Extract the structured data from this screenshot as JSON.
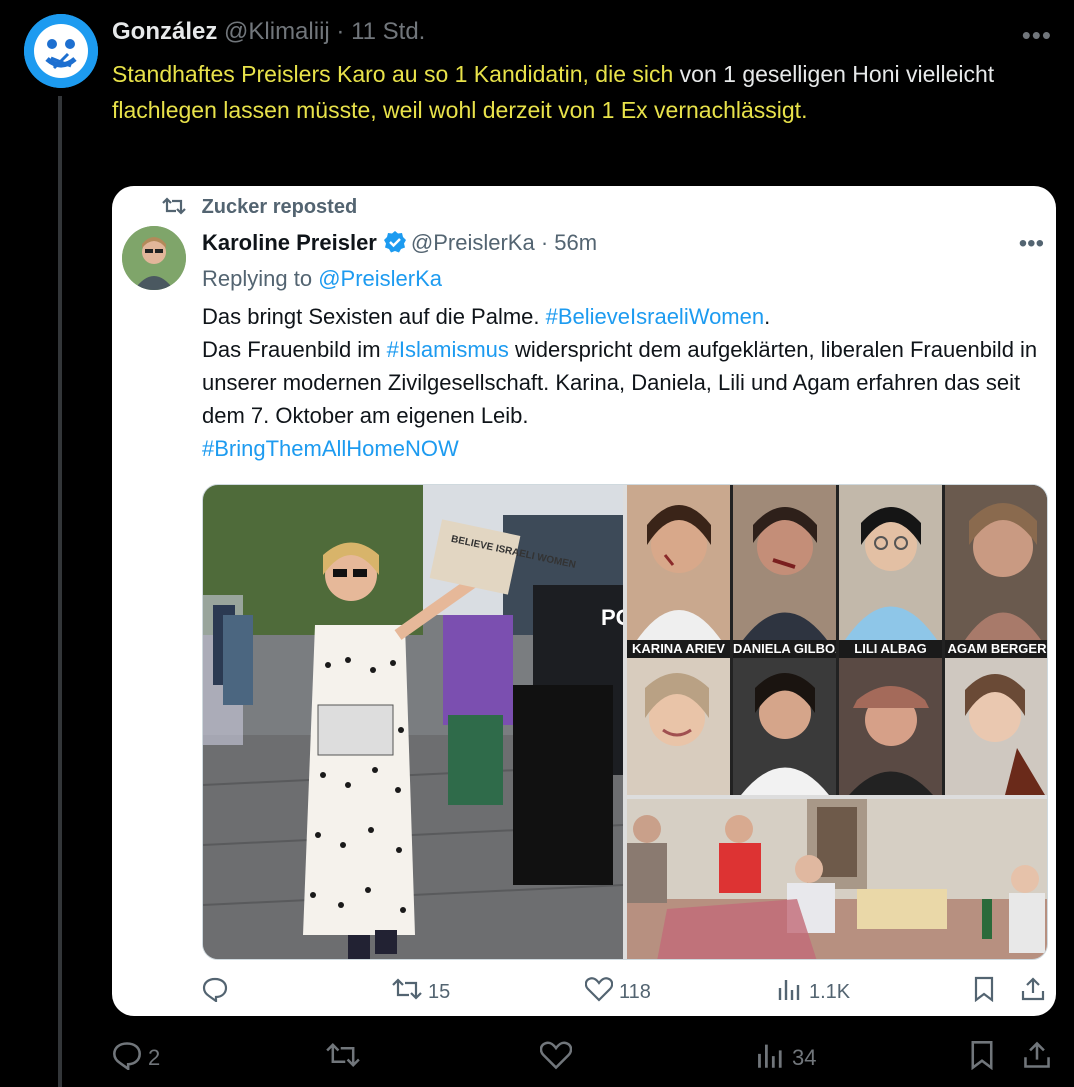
{
  "outer_post": {
    "author_name": "González",
    "handle": "@Klimaliij",
    "separator": "·",
    "time": "11 Std.",
    "text_segments": [
      {
        "text": "Standhaftes Preislers Karo au so 1 Kandidatin, die sich",
        "highlight": true
      },
      {
        "text": " von 1 geselligen Honi vielleicht ",
        "highlight": false
      },
      {
        "text": "flachlegen lassen müsste, weil wohl derzeit von 1 Ex vernachlässigt.",
        "highlight": true
      }
    ],
    "more_icon": "more-dots-icon",
    "actions": {
      "reply_count": "2",
      "repost_count": "",
      "like_count": "",
      "views_count": "34"
    }
  },
  "quoted_post": {
    "repost_label": "Zucker reposted",
    "author_name": "Karoline Preisler",
    "handle": "@PreislerKa",
    "separator": "·",
    "time": "56m",
    "replying_prefix": "Replying to",
    "replying_handle": "@PreislerKa",
    "line1_text": "Das bringt Sexisten auf die Palme. ",
    "line1_tag": "#BelieveIsraeliWomen",
    "line1_end": ".",
    "line2_text": "Das Frauenbild im ",
    "line2_tag": "#Islamismus",
    "line2_rest": " widerspricht dem aufgeklärten, liberalen Frauenbild in unserer modernen Zivilgesellschaft. Karina, Daniela, Lili und Agam erfahren das seit dem 7. Oktober am eigenen Leib.",
    "line3_tag": "#BringThemAllHomeNOW",
    "media": {
      "sign_text": "BELIEVE ISRAELI WOMEN",
      "police_text": "PO",
      "captions": [
        "KARINA ARIEV",
        "DANIELA GILBOA",
        "LILI ALBAG",
        "AGAM BERGER"
      ]
    },
    "actions": {
      "reply_count": "",
      "repost_count": "15",
      "like_count": "118",
      "views_count": "1.1K"
    }
  },
  "colors": {
    "background": "#000000",
    "highlight": "#e8e24a",
    "link": "#1d9bf0",
    "muted": "#71767b"
  }
}
